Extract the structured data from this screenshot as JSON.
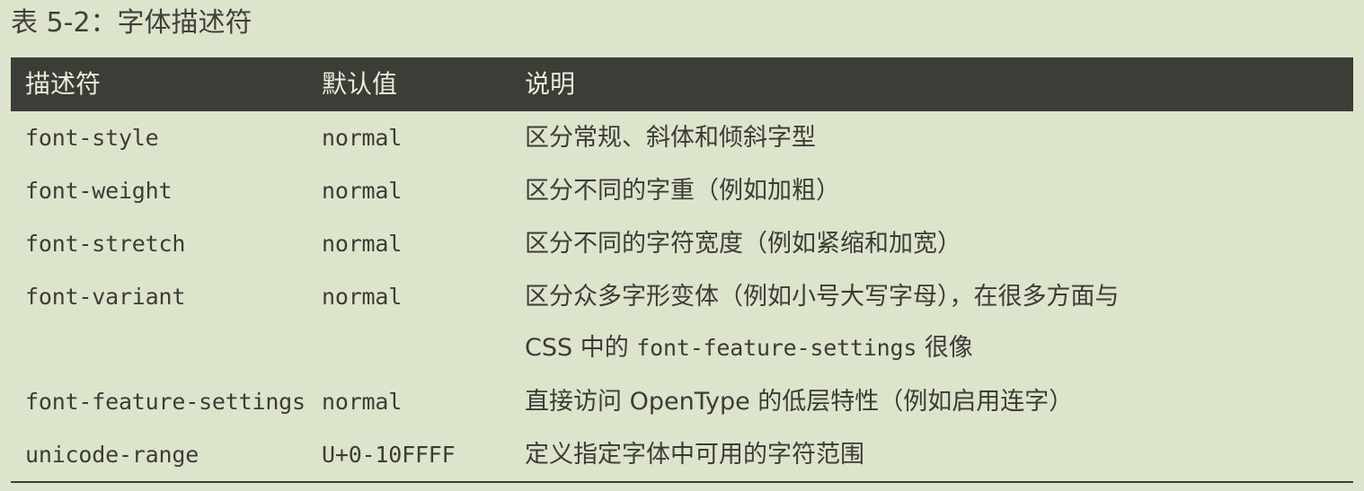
{
  "caption": "表 5-2：字体描述符",
  "table": {
    "headers": [
      "描述符",
      "默认值",
      "说明"
    ],
    "rows": [
      {
        "descriptor": "font-style",
        "default": "normal",
        "description": "区分常规、斜体和倾斜字型"
      },
      {
        "descriptor": "font-weight",
        "default": "normal",
        "description": "区分不同的字重（例如加粗）"
      },
      {
        "descriptor": "font-stretch",
        "default": "normal",
        "description": "区分不同的字符宽度（例如紧缩和加宽）"
      },
      {
        "descriptor": "font-variant",
        "default": "normal",
        "description": "区分众多字形变体（例如小号大写字母），在很多方面与",
        "description_line2_prefix": "CSS 中的 ",
        "description_line2_code": "font-feature-settings",
        "description_line2_suffix": " 很像"
      },
      {
        "descriptor": "font-feature-settings",
        "default": "normal",
        "description": "直接访问 OpenType 的低层特性（例如启用连字）"
      },
      {
        "descriptor": "unicode-range",
        "default": "U+0-10FFFF",
        "description": "定义指定字体中可用的字符范围"
      }
    ]
  }
}
